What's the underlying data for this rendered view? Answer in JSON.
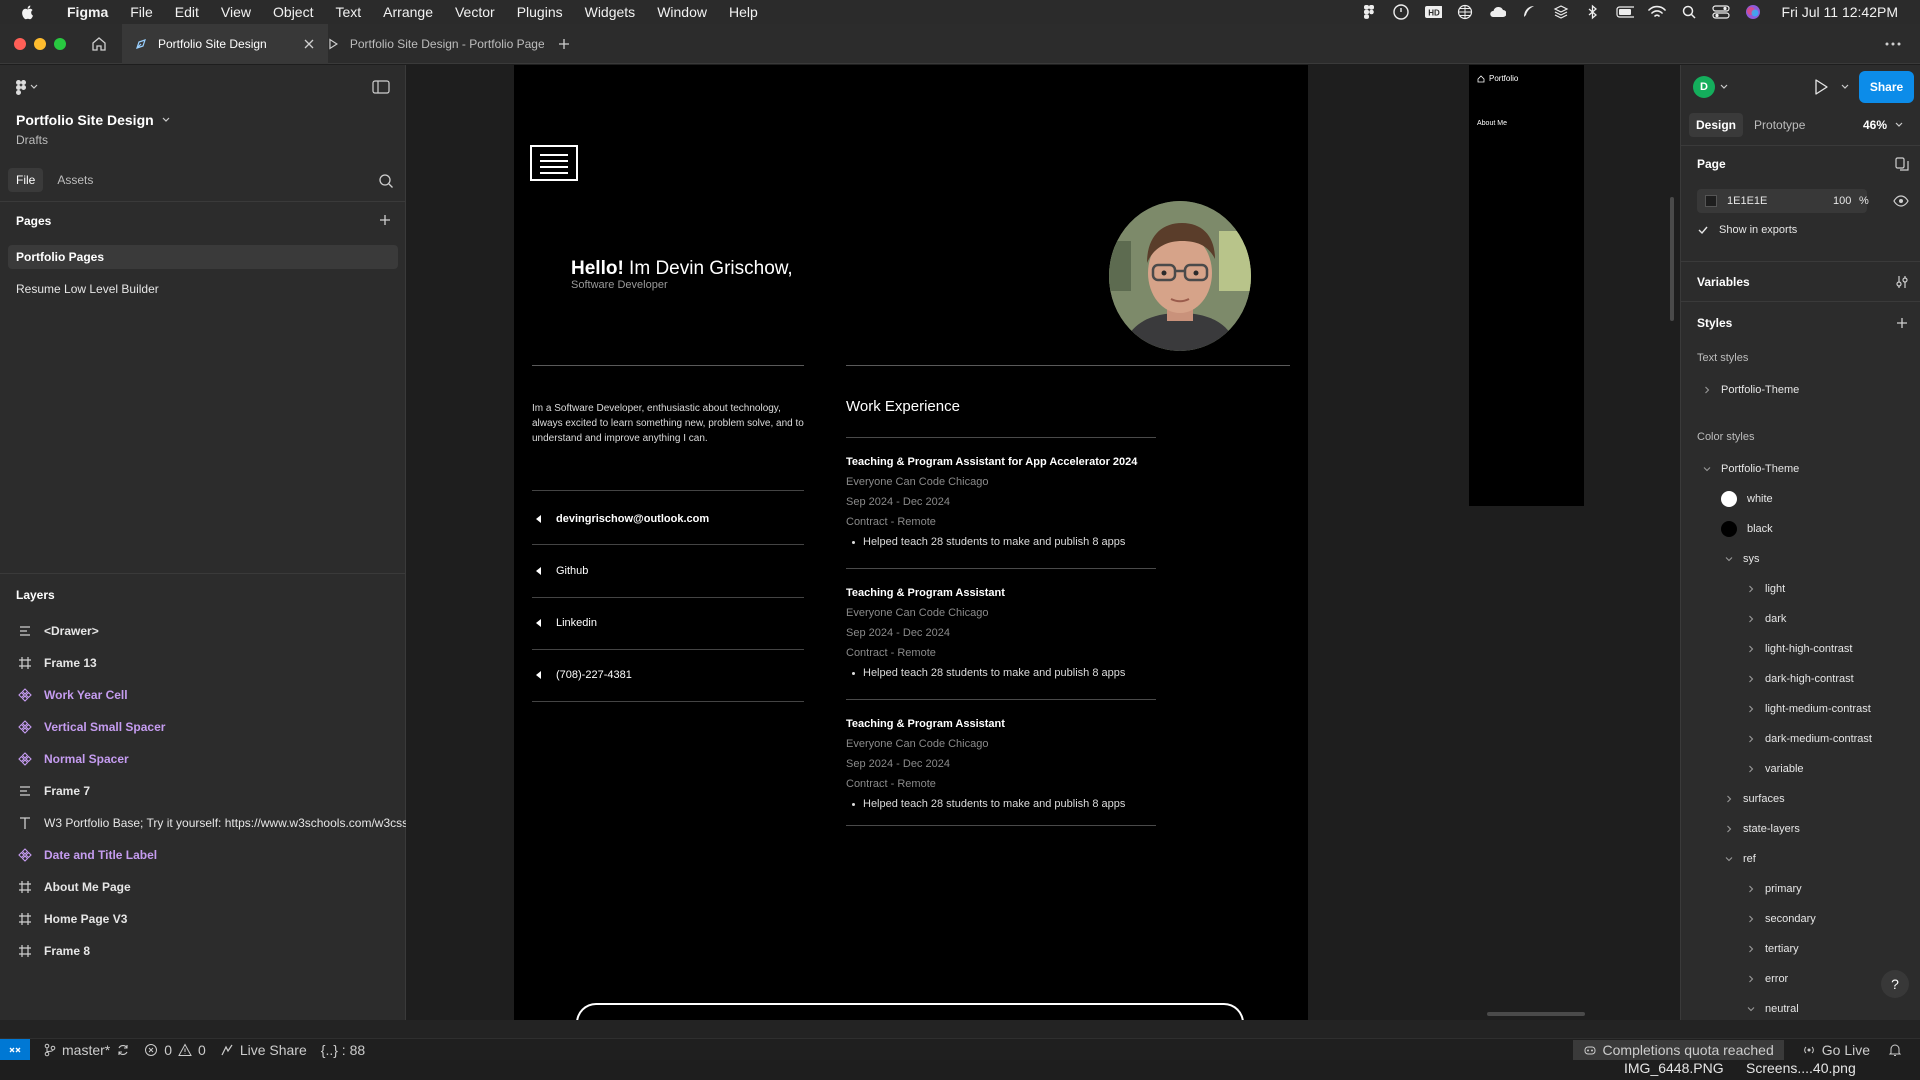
{
  "menubar": {
    "app": "Figma",
    "items": [
      "File",
      "Edit",
      "View",
      "Object",
      "Text",
      "Arrange",
      "Vector",
      "Plugins",
      "Widgets",
      "Window",
      "Help"
    ],
    "clock": "Fri Jul 11  12:42PM"
  },
  "tabs": [
    {
      "label": "Portfolio Site Design",
      "active": true
    },
    {
      "label": "Portfolio Site Design - Portfolio Pages",
      "active": false
    }
  ],
  "left_panel": {
    "file_name": "Portfolio Site Design",
    "location": "Drafts",
    "tabs": [
      "File",
      "Assets"
    ],
    "pages_heading": "Pages",
    "pages": [
      "Portfolio Pages",
      "Resume Low Level Builder"
    ],
    "layers_heading": "Layers",
    "layers": [
      {
        "name": "<Drawer>",
        "kind": "list"
      },
      {
        "name": "Frame 13",
        "kind": "frame"
      },
      {
        "name": "Work Year Cell",
        "kind": "component"
      },
      {
        "name": "Vertical Small Spacer",
        "kind": "component"
      },
      {
        "name": "Normal Spacer",
        "kind": "component"
      },
      {
        "name": "Frame 7",
        "kind": "list"
      },
      {
        "name": "W3 Portfolio Base; Try it yourself: https://www.w3schools.com/w3css",
        "kind": "text"
      },
      {
        "name": "Date and Title Label",
        "kind": "component"
      },
      {
        "name": "About Me Page",
        "kind": "frame"
      },
      {
        "name": "Home Page V3",
        "kind": "frame"
      },
      {
        "name": "Frame 8",
        "kind": "frame"
      }
    ]
  },
  "canvas": {
    "hello_bold": "Hello!",
    "hello_rest": " Im Devin Grischow,",
    "role": "Software Developer",
    "bio": "Im a Software Developer, enthusiastic about technology, always excited to learn something new, problem solve, and to understand and improve anything I can.",
    "contacts": [
      "devingrischow@outlook.com",
      "Github",
      "Linkedin",
      "(708)-227-4381"
    ],
    "work_heading": "Work Experience",
    "work_items": [
      {
        "title": "Teaching & Program Assistant for App Accelerator 2024",
        "org": "Everyone Can Code Chicago",
        "dates": "Sep 2024 - Dec 2024",
        "type": "Contract - Remote",
        "bullet": "Helped teach 28 students to make and publish 8 apps"
      },
      {
        "title": "Teaching & Program Assistant",
        "org": "Everyone Can Code Chicago",
        "dates": "Sep 2024 - Dec 2024",
        "type": "Contract - Remote",
        "bullet": "Helped teach 28 students to make and publish 8 apps"
      },
      {
        "title": "Teaching & Program Assistant",
        "org": "Everyone Can Code Chicago",
        "dates": "Sep 2024 - Dec 2024",
        "type": "Contract - Remote",
        "bullet": "Helped teach 28 students to make and publish 8 apps"
      }
    ],
    "small_frame": {
      "home": "Portfolio",
      "about": "About Me"
    }
  },
  "right_panel": {
    "user_initial": "D",
    "share_label": "Share",
    "tabs": [
      "Design",
      "Prototype"
    ],
    "zoom": "46%",
    "page_heading": "Page",
    "page_fill_hex": "1E1E1E",
    "page_fill_opacity": "100",
    "percent_sign": "%",
    "show_in_exports": "Show in exports",
    "variables_heading": "Variables",
    "styles_heading": "Styles",
    "text_styles_label": "Text styles",
    "text_styles": [
      "Portfolio-Theme"
    ],
    "color_styles_label": "Color styles",
    "color_group": "Portfolio-Theme",
    "color_white": "white",
    "color_black": "black",
    "sys_group": "sys",
    "sys_items": [
      "light",
      "dark",
      "light-high-contrast",
      "dark-high-contrast",
      "light-medium-contrast",
      "dark-medium-contrast",
      "variable"
    ],
    "more_groups": [
      "surfaces",
      "state-layers"
    ],
    "ref_group": "ref",
    "ref_items": [
      "primary",
      "secondary",
      "tertiary",
      "error",
      "neutral"
    ],
    "help": "?"
  },
  "statusbar": {
    "branch": "master*",
    "errors": "0",
    "warnings": "0",
    "live_share": "Live Share",
    "braces": "{..} : 88",
    "quota": "Completions quota reached",
    "go_live": "Go Live"
  },
  "desktop": {
    "file1": "IMG_6448.PNG",
    "file2": "Screens....40.png"
  },
  "colors": {
    "accent": "#0c8ce9",
    "component": "#c59cf0",
    "canvas_bg": "#1e1e1e",
    "panel_bg": "#2c2c2c"
  }
}
